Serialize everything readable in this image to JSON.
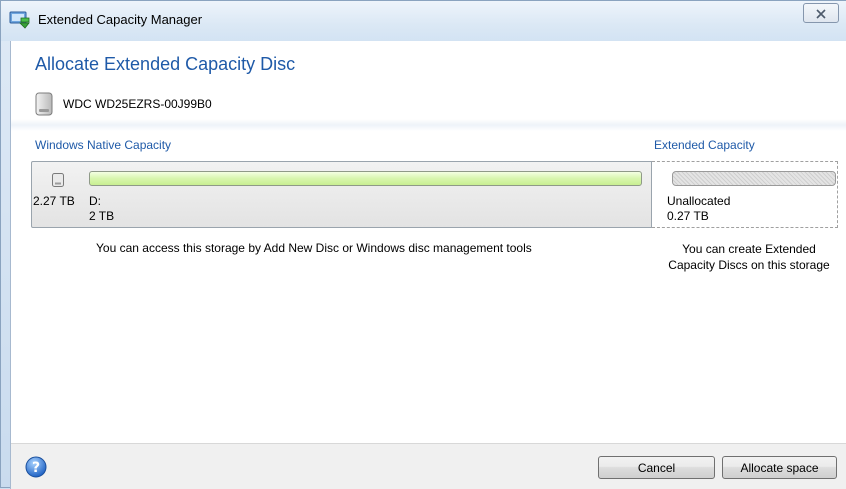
{
  "window": {
    "title": "Extended Capacity Manager",
    "close_icon": "close-icon",
    "app_icon": "disk-manager-icon"
  },
  "page": {
    "heading": "Allocate Extended Capacity Disc",
    "disk_name": "WDC WD25EZRS-00J99B0"
  },
  "native": {
    "label": "Windows Native Capacity",
    "total": "2.27 TB",
    "partition_letter": "D:",
    "partition_size": "2 TB",
    "description": "You can access this storage by Add New Disc or Windows disc management tools"
  },
  "extended": {
    "label": "Extended Capacity",
    "status": "Unallocated",
    "size": "0.27 TB",
    "description_line1": "You can create Extended",
    "description_line2": "Capacity Discs on this storage"
  },
  "footer": {
    "help_icon": "help-icon",
    "cancel_label": "Cancel",
    "allocate_label": "Allocate space"
  },
  "colors": {
    "accent": "#1f5aa8",
    "bar_green": "#c9ef92",
    "bar_gray": "#e4e4e4"
  }
}
